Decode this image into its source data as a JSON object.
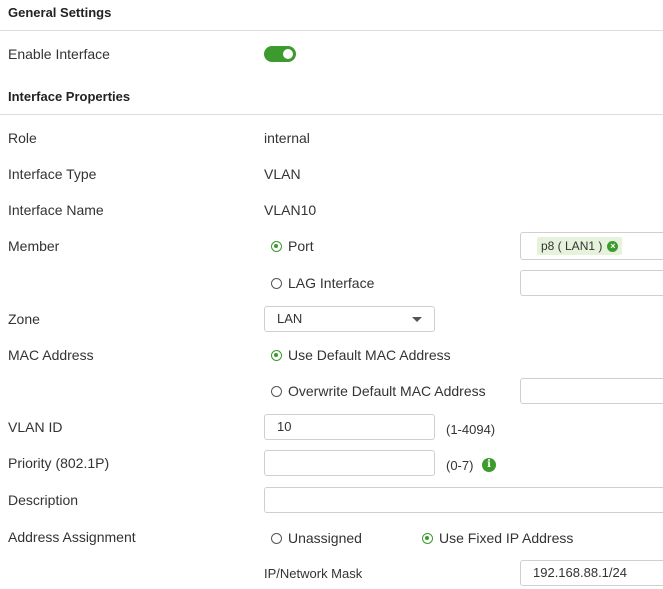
{
  "sections": {
    "general": "General Settings",
    "properties": "Interface Properties"
  },
  "fields": {
    "enable_interface": {
      "label": "Enable Interface",
      "enabled": true
    },
    "role": {
      "label": "Role",
      "value": "internal"
    },
    "interface_type": {
      "label": "Interface Type",
      "value": "VLAN"
    },
    "interface_name": {
      "label": "Interface Name",
      "value": "VLAN10"
    },
    "member": {
      "label": "Member",
      "port_option": "Port",
      "lag_option": "LAG Interface",
      "selected": "Port",
      "chip_label": "p8 ( LAN1 )"
    },
    "zone": {
      "label": "Zone",
      "value": "LAN"
    },
    "mac_address": {
      "label": "MAC Address",
      "default_option": "Use Default MAC Address",
      "overwrite_option": "Overwrite Default MAC Address",
      "selected": "Use Default MAC Address"
    },
    "vlan_id": {
      "label": "VLAN ID",
      "value": "10",
      "hint": "(1-4094)"
    },
    "priority": {
      "label": "Priority (802.1P)",
      "value": "",
      "hint": "(0-7)"
    },
    "description": {
      "label": "Description",
      "value": ""
    },
    "address_assignment": {
      "label": "Address Assignment",
      "unassigned_option": "Unassigned",
      "fixed_option": "Use Fixed IP Address",
      "selected": "Use Fixed IP Address"
    },
    "ip_mask": {
      "label": "IP/Network Mask",
      "value": "192.168.88.1/24"
    }
  },
  "colors": {
    "accent": "#3c9b2d",
    "chip_bg": "#e6f2dc",
    "divider": "#dcdcdc",
    "text": "#333333"
  },
  "icons": {
    "chip_remove": "close-circle-icon",
    "priority_info": "info-icon",
    "zone_dropdown": "chevron-down-icon"
  }
}
